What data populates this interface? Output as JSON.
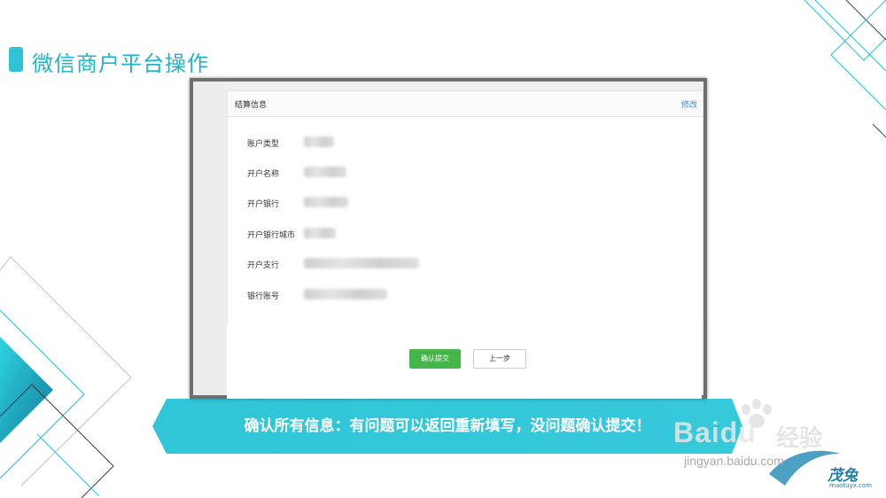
{
  "header": {
    "title": "微信商户平台操作"
  },
  "panel": {
    "title": "结算信息",
    "edit_label": "修改",
    "rows": [
      {
        "label": "账户类型"
      },
      {
        "label": "开户名称"
      },
      {
        "label": "开户银行"
      },
      {
        "label": "开户银行城市"
      },
      {
        "label": "开户支行"
      },
      {
        "label": "银行账号"
      }
    ]
  },
  "actions": {
    "confirm_label": "确认提交",
    "prev_label": "上一步"
  },
  "banner": {
    "text": "确认所有信息：有问题可以返回重新填写，没问题确认提交！"
  },
  "watermark": {
    "baidu": "Baidu",
    "jingyan_cn": "经验",
    "jingyan_url": "jingyan.baidu.com",
    "brand": "茂兔",
    "brand_url": "maotuyx.com"
  },
  "colors": {
    "accent": "#2fc3d6",
    "confirm_button": "#44b549",
    "edit_link": "#3e89d6"
  }
}
